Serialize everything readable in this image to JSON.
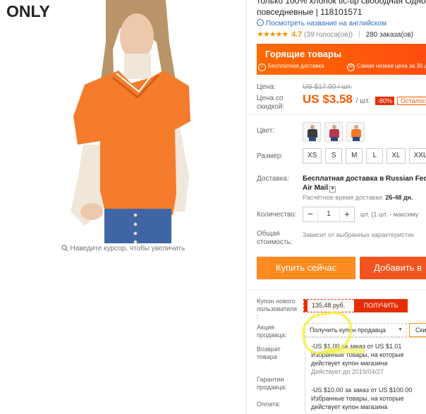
{
  "product": {
    "brand": "ONLY",
    "title_line1": "только 100% хлопок tic-tip свободная Одно",
    "title_line2": "повседневные | 118101571",
    "translate_link": "Посмотреть название на английском",
    "stars": "★★★★★",
    "rating": "4.7",
    "votes": "(39 голоса(ов))",
    "orders": "280 заказа(ов)",
    "zoom_hint": "Наведите курсор, чтобы увеличить"
  },
  "hot_banner": {
    "title": "Горящие товары",
    "feature1": "Бесплатная доставка",
    "feature2_num": "30",
    "feature2": "Самая низкая цена за 30 дн"
  },
  "pricing": {
    "label_price": "Цена:",
    "old_price": "US $17.90 / шт.",
    "label_discount_l1": "Цена со",
    "label_discount_l2": "скидкой:",
    "new_price": "US $3.58",
    "unit": "/ шт.",
    "discount": "-80%",
    "remaining": "Осталось"
  },
  "options": {
    "color_label": "Цвет:",
    "color_swatches": [
      "#3d3d3d",
      "#b8394a",
      "#f07a2a"
    ],
    "size_label": "Размер:",
    "sizes": [
      "XS",
      "S",
      "M",
      "L",
      "XL",
      "XXL"
    ]
  },
  "shipping": {
    "label": "Доставка:",
    "line1": "Бесплатная доставка в Russian Feder",
    "line2": "Air Mail",
    "time_label": "Расчётное время доставки:",
    "time_value": "26-48 дн."
  },
  "quantity": {
    "label": "Количество:",
    "value": "1",
    "minus": "−",
    "plus": "+",
    "note": "шт. (1 шт. - максиму"
  },
  "total": {
    "label_l1": "Общая",
    "label_l2": "стоимость:",
    "note": "Зависит от выбранных характеристик"
  },
  "actions": {
    "buy_now": "Купить сейчас",
    "add_to_cart": "Добавить в"
  },
  "coupons": {
    "new_user_label_l1": "Купон нового",
    "new_user_label_l2": "пользователя",
    "new_user_label_l3": ":",
    "amount": "135,48 руб.",
    "get_button": "ПОЛУЧИТЬ",
    "seller_label_l1": "Акция",
    "seller_label_l2": "продавца:",
    "seller_select": "Получить купон продавца",
    "seller_other": "Ски",
    "return_label_l1": "Возврат",
    "return_label_l2": "товара",
    "warranty_label_l1": "Гарантии",
    "warranty_label_l2": "продавца:",
    "payment_label": "Оплата:",
    "items": [
      {
        "line1": "-US $1.00 за заказ от US $1.01",
        "line2": "Избранные товары, на которые",
        "line3": "действует купон магазина",
        "date": "Действует до 2019/04/27"
      },
      {
        "line1": "-US $10.00 за заказ от US $100.00",
        "line2": "Избранные товары, на которые",
        "line3": "действует купон магазина"
      }
    ]
  }
}
